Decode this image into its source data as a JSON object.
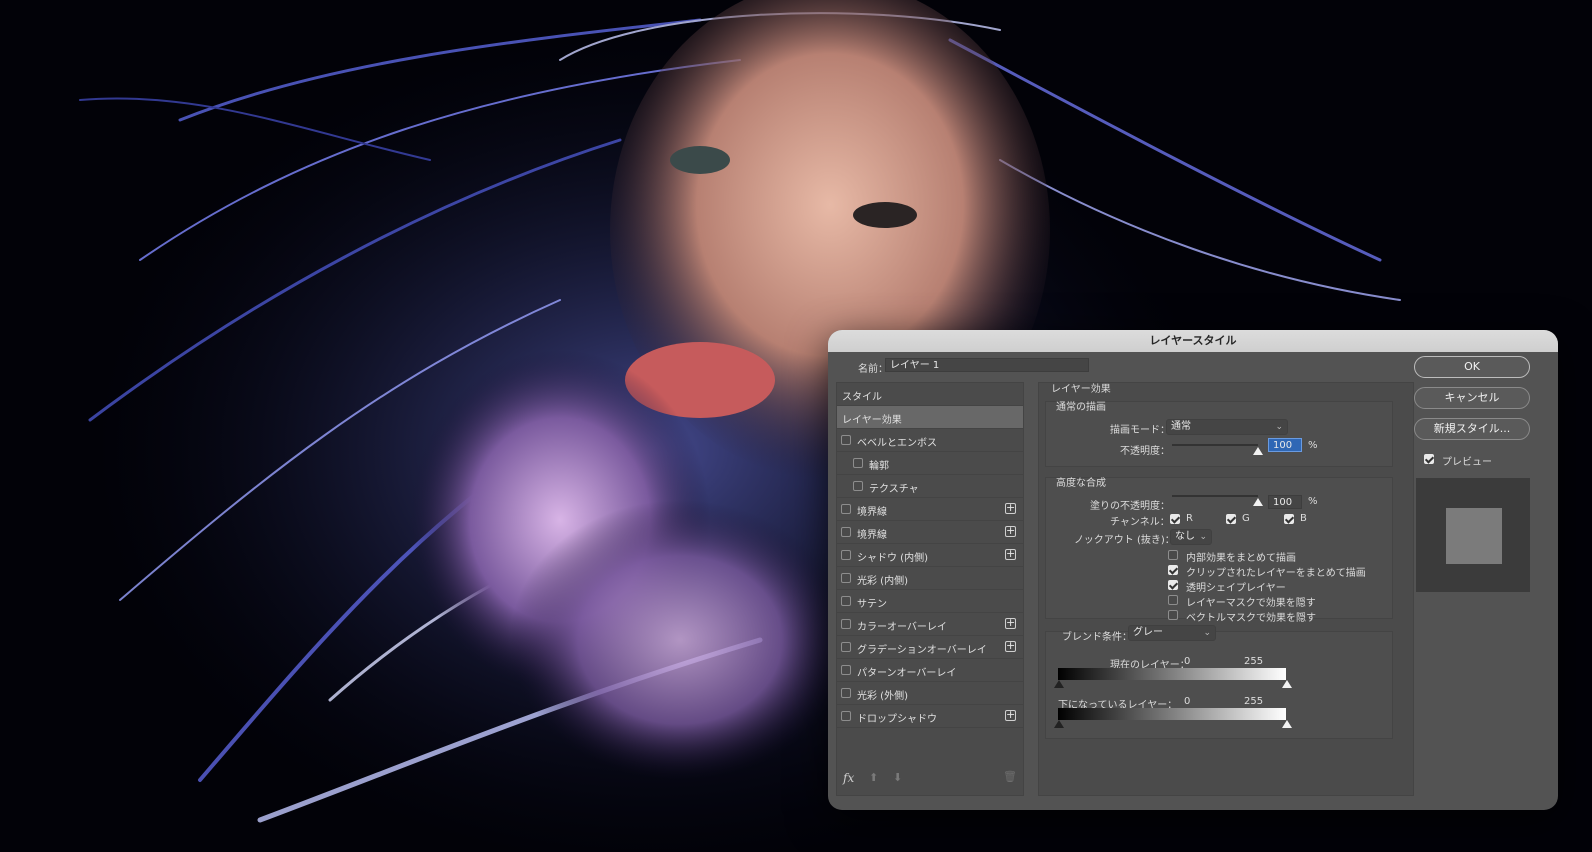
{
  "dialog": {
    "title": "レイヤースタイル",
    "name_label": "名前：",
    "name_value": "レイヤー 1"
  },
  "buttons": {
    "ok": "OK",
    "cancel": "キャンセル",
    "new_style": "新規スタイル...",
    "preview_label": "プレビュー",
    "preview_checked": true
  },
  "style_list": {
    "header": "スタイル",
    "items": [
      {
        "label": "レイヤー効果",
        "checked": null,
        "plus": false,
        "indent": 0
      },
      {
        "label": "ベベルとエンボス",
        "checked": false,
        "plus": false,
        "indent": 1
      },
      {
        "label": "輪郭",
        "checked": false,
        "plus": false,
        "indent": 2
      },
      {
        "label": "テクスチャ",
        "checked": false,
        "plus": false,
        "indent": 2
      },
      {
        "label": "境界線",
        "checked": false,
        "plus": true,
        "indent": 1
      },
      {
        "label": "境界線",
        "checked": false,
        "plus": true,
        "indent": 1
      },
      {
        "label": "シャドウ (内側)",
        "checked": false,
        "plus": true,
        "indent": 1
      },
      {
        "label": "光彩 (内側)",
        "checked": false,
        "plus": false,
        "indent": 1
      },
      {
        "label": "サテン",
        "checked": false,
        "plus": false,
        "indent": 1
      },
      {
        "label": "カラーオーバーレイ",
        "checked": false,
        "plus": true,
        "indent": 1
      },
      {
        "label": "グラデーションオーバーレイ",
        "checked": false,
        "plus": true,
        "indent": 1
      },
      {
        "label": "パターンオーバーレイ",
        "checked": false,
        "plus": false,
        "indent": 1
      },
      {
        "label": "光彩 (外側)",
        "checked": false,
        "plus": false,
        "indent": 1
      },
      {
        "label": "ドロップシャドウ",
        "checked": false,
        "plus": true,
        "indent": 1
      }
    ],
    "footer_fx": "fx"
  },
  "effects": {
    "section_title": "レイヤー効果",
    "normal_title": "通常の描画",
    "blend_mode_label": "描画モード：",
    "blend_mode_value": "通常",
    "opacity_label": "不透明度：",
    "opacity_value": "100",
    "opacity_percent": 1.0,
    "percent": "%",
    "advanced_title": "高度な合成",
    "fill_opacity_label": "塗りの不透明度：",
    "fill_opacity_value": "100",
    "fill_opacity_percent": 1.0,
    "channels_label": "チャンネル：",
    "channels": [
      {
        "label": "R",
        "checked": true
      },
      {
        "label": "G",
        "checked": true
      },
      {
        "label": "B",
        "checked": true
      }
    ],
    "knockout_label": "ノックアウト (抜き)：",
    "knockout_value": "なし",
    "options": [
      {
        "label": "内部効果をまとめて描画",
        "checked": false
      },
      {
        "label": "クリップされたレイヤーをまとめて描画",
        "checked": true
      },
      {
        "label": "透明シェイプレイヤー",
        "checked": true
      },
      {
        "label": "レイヤーマスクで効果を隠す",
        "checked": false
      },
      {
        "label": "ベクトルマスクで効果を隠す",
        "checked": false
      }
    ],
    "blend_if_label": "ブレンド条件：",
    "blend_if_value": "グレー",
    "this_layer_label": "現在のレイヤー：",
    "this_layer_min": "0",
    "this_layer_max": "255",
    "underlying_label": "下になっているレイヤー：",
    "underlying_min": "0",
    "underlying_max": "255"
  }
}
